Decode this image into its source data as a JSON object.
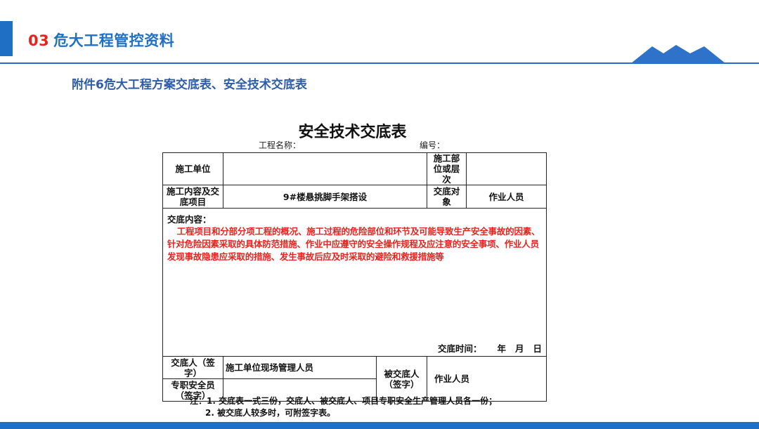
{
  "header": {
    "section_number": "03",
    "section_title": "危大工程管控资料",
    "subtitle": "附件6危大工程方案交底表、安全技术交底表",
    "accent_color": "#1F6FC5",
    "number_color": "#E8231E"
  },
  "document": {
    "title": "安全技术交底表",
    "project_name_label": "工程名称：",
    "serial_label": "编号：",
    "rows": {
      "construction_unit_label": "施工单位",
      "construction_unit_value": "",
      "location_label": "施工部位或层次",
      "location_value": "",
      "content_item_label": "施工内容及交底项目",
      "content_item_value": "9#楼悬挑脚手架搭设",
      "target_label": "交底对象",
      "target_value": "作业人员"
    },
    "content": {
      "label": "交底内容：",
      "text": "工程项目和分部分项工程的概况、施工过程的危险部位和环节及可能导致生产安全事故的因素、针对危险因素采取的具体防范措施、作业中应遵守的安全操作规程及应注意的安全事项、作业人员发现事故隐患应采取的措施、发生事故后应及时采取的避险和救援措施等"
    },
    "handover_time": {
      "label": "交底时间：",
      "year": "年",
      "month": "月",
      "day": "日"
    },
    "signatures": {
      "giver_label": "交底人（签字）",
      "giver_value": "施工单位现场管理人员",
      "safety_officer_label": "专职安全员（签字）",
      "safety_officer_value": "",
      "receiver_label": "被交底人（签字）",
      "receiver_value": "作业人员"
    },
    "notes": {
      "line1": "注：1. 交底表一式三份，交底人、被交底人、项目专职安全生产管理人员各一份；",
      "line2": "2. 被交底人较多时，可附签字表。"
    },
    "highlight_color": "#E8231E"
  }
}
